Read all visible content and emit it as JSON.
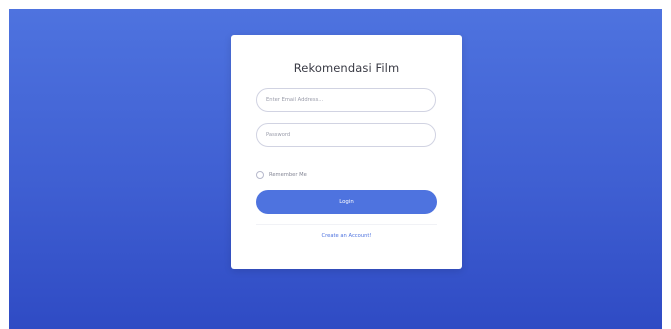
{
  "login": {
    "title": "Rekomendasi Film",
    "email_placeholder": "Enter Email Address...",
    "email_value": "",
    "password_placeholder": "Password",
    "password_value": "",
    "remember_label": "Remember Me",
    "login_label": "Login",
    "create_account_label": "Create an Account!"
  },
  "colors": {
    "accent": "#4e73df",
    "background_top": "#4e73df",
    "background_bottom": "#2f4bc4",
    "card": "#ffffff"
  }
}
